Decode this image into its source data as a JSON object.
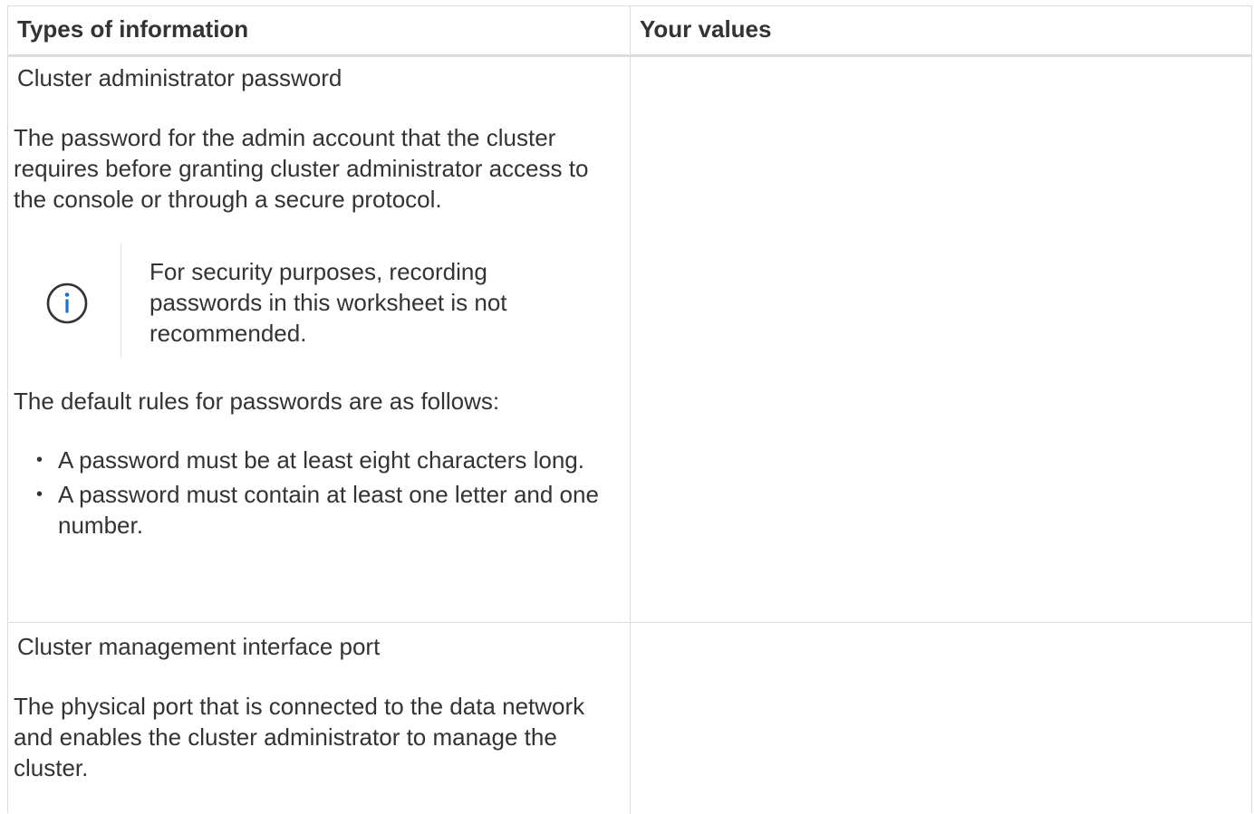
{
  "table": {
    "headers": {
      "col1": "Types of information",
      "col2": "Your values"
    },
    "rows": [
      {
        "title": "Cluster administrator password",
        "description": "The password for the admin account that the cluster requires before granting cluster administrator access to the console or through a secure protocol.",
        "note": {
          "icon": "info-icon",
          "text": "For security purposes, recording passwords in this worksheet is not recommended."
        },
        "rules_intro": "The default rules for passwords are as follows:",
        "rules": [
          "A password must be at least eight characters long.",
          "A password must contain at least one letter and one number."
        ],
        "value": ""
      },
      {
        "title": "Cluster management interface port",
        "description": "The physical port that is connected to the data network and enables the cluster administrator to manage the cluster.",
        "value": ""
      }
    ]
  },
  "colors": {
    "border": "#dcdcdc",
    "text": "#333333",
    "info_icon_ring": "#333333",
    "info_icon_glyph": "#1a73c9"
  }
}
